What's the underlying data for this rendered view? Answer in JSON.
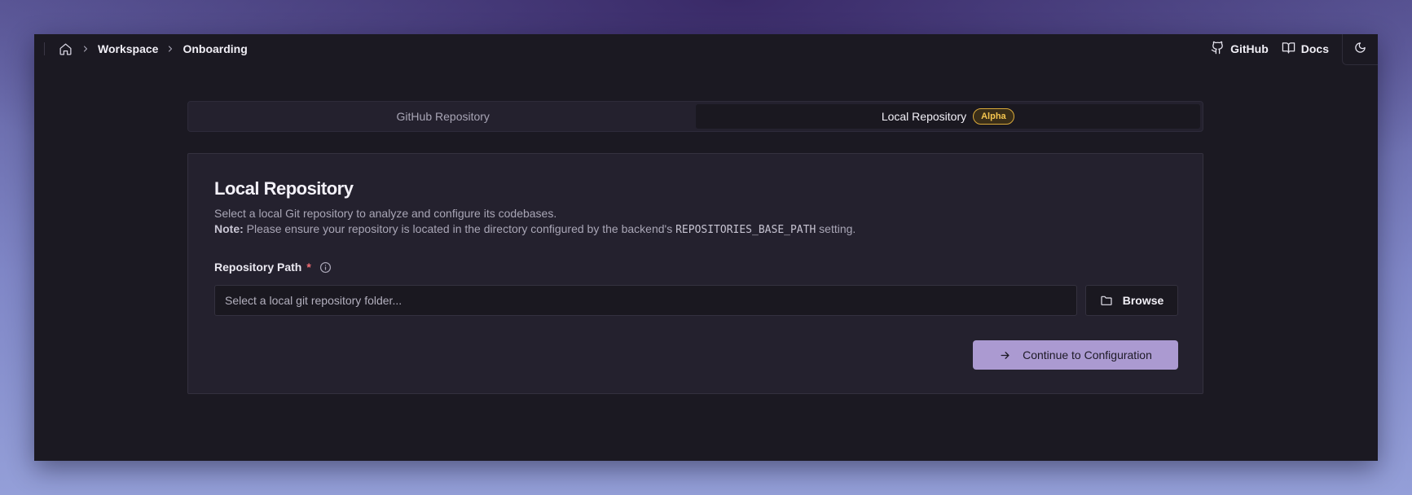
{
  "breadcrumb": {
    "home_icon": "home-icon",
    "items": [
      {
        "label": "Workspace"
      },
      {
        "label": "Onboarding"
      }
    ]
  },
  "nav": {
    "github_label": "GitHub",
    "github_icon": "github-icon",
    "docs_label": "Docs",
    "docs_icon": "book-open-icon",
    "theme_icon": "moon-icon"
  },
  "tabs": [
    {
      "label": "GitHub Repository",
      "active": false
    },
    {
      "label": "Local Repository",
      "active": true,
      "badge": "Alpha"
    }
  ],
  "card": {
    "title": "Local Repository",
    "description": "Select a local Git repository to analyze and configure its codebases.",
    "note_label": "Note:",
    "note_text_before": " Please ensure your repository is located in the directory configured by the backend's ",
    "note_code": "REPOSITORIES_BASE_PATH",
    "note_text_after": " setting."
  },
  "form": {
    "repo_path_label": "Repository Path",
    "required_marker": "*",
    "repo_path_placeholder": "Select a local git repository folder...",
    "repo_path_value": "",
    "browse_label": "Browse",
    "continue_label": "Continue to Configuration"
  },
  "colors": {
    "window_bg": "#1b1922",
    "card_bg": "#24212e",
    "accent_button": "#ab9ad1",
    "badge_text": "#f5c64f",
    "required": "#f06d73"
  }
}
